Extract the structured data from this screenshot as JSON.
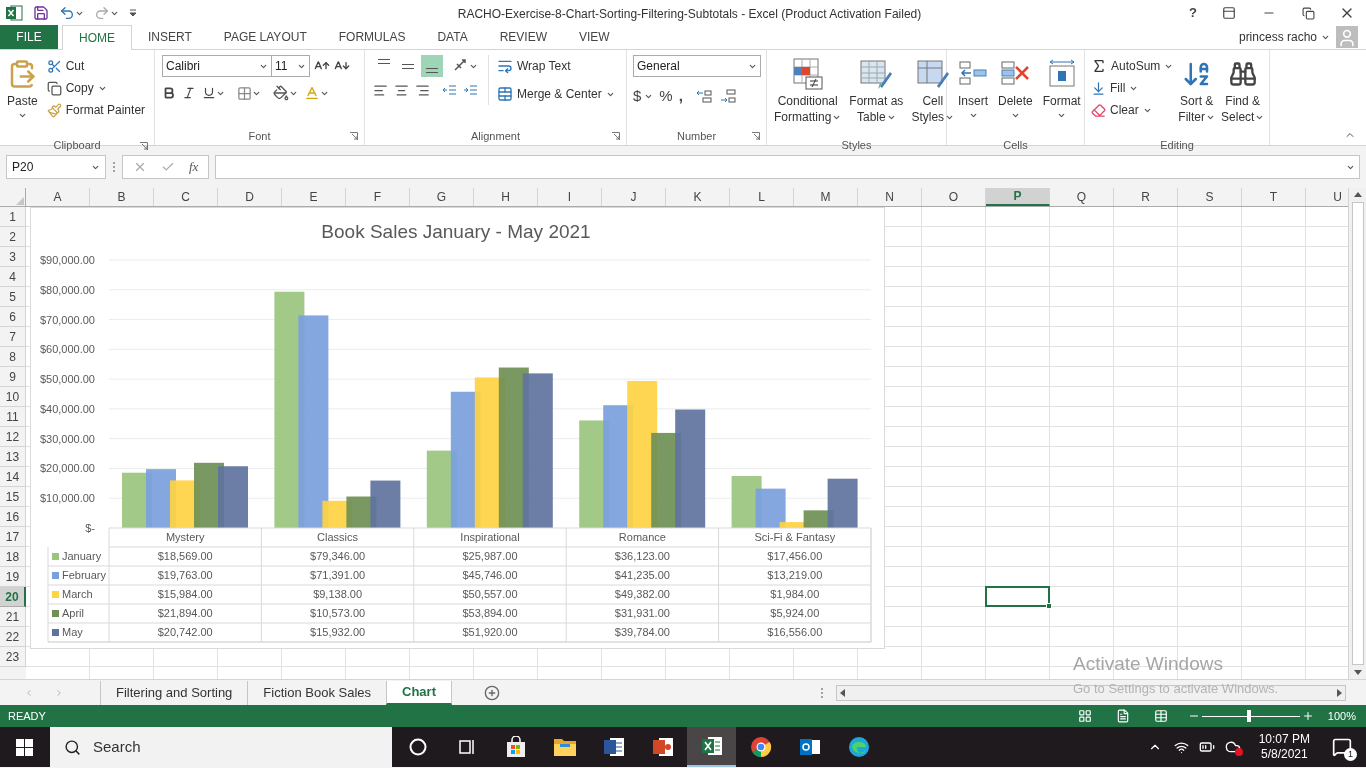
{
  "window": {
    "title": "RACHO-Exercise-8-Chart-Sorting-Filtering-Subtotals - Excel (Product Activation Failed)",
    "help": "?"
  },
  "menu_tabs": [
    {
      "label": "FILE",
      "kind": "file",
      "selected": false
    },
    {
      "label": "HOME",
      "kind": "tab",
      "selected": true
    },
    {
      "label": "INSERT",
      "kind": "tab",
      "selected": false
    },
    {
      "label": "PAGE LAYOUT",
      "kind": "tab",
      "selected": false
    },
    {
      "label": "FORMULAS",
      "kind": "tab",
      "selected": false
    },
    {
      "label": "DATA",
      "kind": "tab",
      "selected": false
    },
    {
      "label": "REVIEW",
      "kind": "tab",
      "selected": false
    },
    {
      "label": "VIEW",
      "kind": "tab",
      "selected": false
    }
  ],
  "user": {
    "name": "princess racho"
  },
  "ribbon": {
    "clipboard": {
      "label": "Clipboard",
      "paste": "Paste",
      "cut": "Cut",
      "copy": "Copy",
      "format_painter": "Format Painter"
    },
    "font": {
      "label": "Font",
      "font_name": "Calibri",
      "font_size": "11"
    },
    "alignment": {
      "label": "Alignment",
      "vertical": [
        {
          "selected": false
        },
        {
          "selected": false
        },
        {
          "selected": true
        }
      ],
      "wrap_text": "Wrap Text",
      "merge": "Merge & Center"
    },
    "number": {
      "label": "Number",
      "format": "General",
      "currency": "$",
      "percent": "%",
      "comma": ","
    },
    "styles": {
      "label": "Styles",
      "buttons": [
        {
          "kind": "conditional",
          "lines": [
            "Conditional",
            "Formatting"
          ]
        },
        {
          "kind": "table",
          "lines": [
            "Format as",
            "Table"
          ]
        },
        {
          "kind": "cellstyles",
          "lines": [
            "Cell",
            "Styles"
          ]
        }
      ]
    },
    "cells": {
      "label": "Cells",
      "buttons": [
        {
          "kind": "insert",
          "lines": [
            "Insert"
          ]
        },
        {
          "kind": "delete",
          "lines": [
            "Delete"
          ]
        },
        {
          "kind": "format",
          "lines": [
            "Format"
          ]
        }
      ]
    },
    "editing": {
      "label": "Editing",
      "autosum": "AutoSum",
      "fill": "Fill",
      "clear": "Clear",
      "buttons": [
        {
          "kind": "sort",
          "lines": [
            "Sort &",
            "Filter"
          ]
        },
        {
          "kind": "find",
          "lines": [
            "Find &",
            "Select"
          ]
        }
      ]
    }
  },
  "formula_bar": {
    "name_box": "P20",
    "function_label": "fx"
  },
  "sheet": {
    "columns": [
      {
        "label": "A",
        "selected": false
      },
      {
        "label": "B",
        "selected": false
      },
      {
        "label": "C",
        "selected": false
      },
      {
        "label": "D",
        "selected": false
      },
      {
        "label": "E",
        "selected": false
      },
      {
        "label": "F",
        "selected": false
      },
      {
        "label": "G",
        "selected": false
      },
      {
        "label": "H",
        "selected": false
      },
      {
        "label": "I",
        "selected": false
      },
      {
        "label": "J",
        "selected": false
      },
      {
        "label": "K",
        "selected": false
      },
      {
        "label": "L",
        "selected": false
      },
      {
        "label": "M",
        "selected": false
      },
      {
        "label": "N",
        "selected": false
      },
      {
        "label": "O",
        "selected": false
      },
      {
        "label": "P",
        "selected": true
      },
      {
        "label": "Q",
        "selected": false
      },
      {
        "label": "R",
        "selected": false
      },
      {
        "label": "S",
        "selected": false
      },
      {
        "label": "T",
        "selected": false
      },
      {
        "label": "U",
        "selected": false
      }
    ],
    "rows": [
      {
        "label": "1",
        "selected": false
      },
      {
        "label": "2",
        "selected": false
      },
      {
        "label": "3",
        "selected": false
      },
      {
        "label": "4",
        "selected": false
      },
      {
        "label": "5",
        "selected": false
      },
      {
        "label": "6",
        "selected": false
      },
      {
        "label": "7",
        "selected": false
      },
      {
        "label": "8",
        "selected": false
      },
      {
        "label": "9",
        "selected": false
      },
      {
        "label": "10",
        "selected": false
      },
      {
        "label": "11",
        "selected": false
      },
      {
        "label": "12",
        "selected": false
      },
      {
        "label": "13",
        "selected": false
      },
      {
        "label": "14",
        "selected": false
      },
      {
        "label": "15",
        "selected": false
      },
      {
        "label": "16",
        "selected": false
      },
      {
        "label": "17",
        "selected": false
      },
      {
        "label": "18",
        "selected": false
      },
      {
        "label": "19",
        "selected": false
      },
      {
        "label": "20",
        "selected": true
      },
      {
        "label": "21",
        "selected": false
      },
      {
        "label": "22",
        "selected": false
      },
      {
        "label": "23",
        "selected": false
      }
    ]
  },
  "chart": {
    "chart_data": {
      "type": "bar",
      "title": "Book Sales January - May 2021",
      "categories": [
        "Mystery",
        "Classics",
        "Inspirational",
        "Romance",
        "Sci-Fi & Fantasy"
      ],
      "series": [
        {
          "name": "January",
          "color": "#9bc47f",
          "values": [
            18569,
            79346,
            25987,
            36123,
            17456
          ]
        },
        {
          "name": "February",
          "color": "#7b9fdc",
          "values": [
            19763,
            71391,
            45746,
            41235,
            13219
          ]
        },
        {
          "name": "March",
          "color": "#ffd343",
          "values": [
            15984,
            9138,
            50557,
            49382,
            1984
          ]
        },
        {
          "name": "April",
          "color": "#6f8f55",
          "values": [
            21894,
            10573,
            53894,
            31931,
            5924
          ]
        },
        {
          "name": "May",
          "color": "#5f739e",
          "values": [
            20742,
            15932,
            51920,
            39784,
            16556
          ]
        }
      ],
      "ylim": [
        0,
        90000
      ],
      "grid": true,
      "legend": "bottom",
      "yticks": [
        {
          "value": 0,
          "label": "$-"
        },
        {
          "value": 10000,
          "label": "$10,000.00"
        },
        {
          "value": 20000,
          "label": "$20,000.00"
        },
        {
          "value": 30000,
          "label": "$30,000.00"
        },
        {
          "value": 40000,
          "label": "$40,000.00"
        },
        {
          "value": 50000,
          "label": "$50,000.00"
        },
        {
          "value": 60000,
          "label": "$60,000.00"
        },
        {
          "value": 70000,
          "label": "$70,000.00"
        },
        {
          "value": 80000,
          "label": "$80,000.00"
        },
        {
          "value": 90000,
          "label": "$90,000.00"
        }
      ]
    },
    "data_table": [
      [
        "$18,569.00",
        "$79,346.00",
        "$25,987.00",
        "$36,123.00",
        "$17,456.00"
      ],
      [
        "$19,763.00",
        "$71,391.00",
        "$45,746.00",
        "$41,235.00",
        "$13,219.00"
      ],
      [
        "$15,984.00",
        "$9,138.00",
        "$50,557.00",
        "$49,382.00",
        "$1,984.00"
      ],
      [
        "$21,894.00",
        "$10,573.00",
        "$53,894.00",
        "$31,931.00",
        "$5,924.00"
      ],
      [
        "$20,742.00",
        "$15,932.00",
        "$51,920.00",
        "$39,784.00",
        "$16,556.00"
      ]
    ]
  },
  "sheet_tabs": [
    {
      "label": "Filtering and Sorting",
      "selected": false
    },
    {
      "label": "Fiction Book Sales",
      "selected": false
    },
    {
      "label": "Chart",
      "selected": true
    }
  ],
  "status_bar": {
    "status": "READY",
    "zoom": "100%",
    "zoom_slider": {
      "level": 0.48
    }
  },
  "taskbar": {
    "search_placeholder": "Search",
    "time": "10:07 PM",
    "date": "5/8/2021",
    "notifications": "1",
    "apps": [
      {
        "kind": "cortana",
        "selected": false
      },
      {
        "kind": "taskview",
        "selected": false
      },
      {
        "kind": "store",
        "selected": false
      },
      {
        "kind": "explorer",
        "selected": false
      },
      {
        "kind": "word",
        "selected": false
      },
      {
        "kind": "powerpoint",
        "selected": false
      },
      {
        "kind": "excel",
        "selected": true
      },
      {
        "kind": "chrome",
        "selected": false
      },
      {
        "kind": "outlook",
        "selected": false
      },
      {
        "kind": "edge",
        "selected": false
      }
    ]
  },
  "activation_notice": {
    "title": "Activate Windows",
    "message": "Go to Settings to activate Windows."
  }
}
